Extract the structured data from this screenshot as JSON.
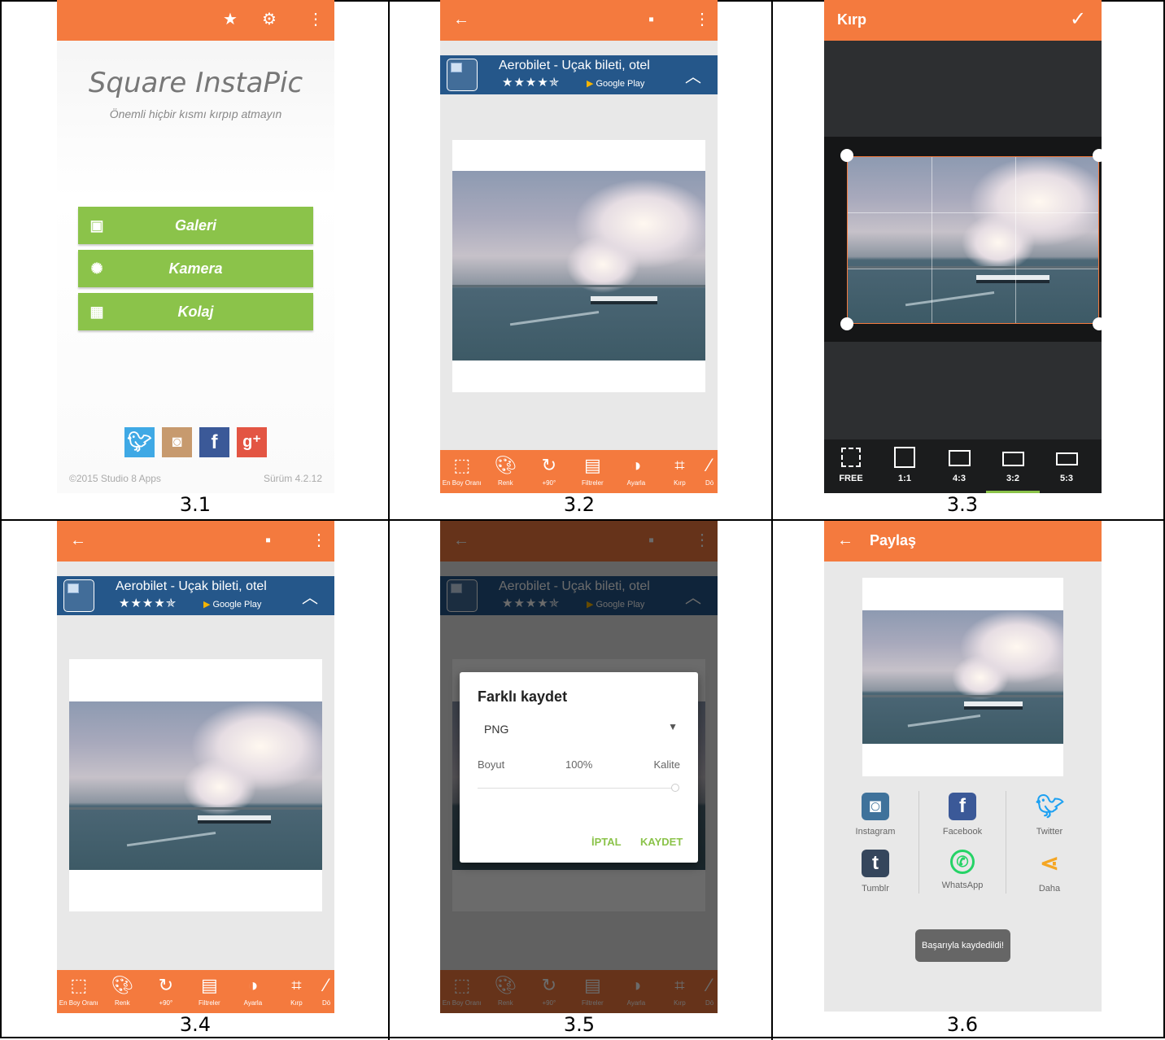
{
  "captions": [
    "3.1",
    "3.2",
    "3.3",
    "3.4",
    "3.5",
    "3.6"
  ],
  "colors": {
    "accent": "#f47a3e",
    "green": "#8bc34a",
    "ad_bg": "#25578a",
    "crop_bg": "#2d2f31"
  },
  "screen1": {
    "app_title": "Square InstaPic",
    "subtitle": "Önemli hiçbir kısmı kırpıp atmayın",
    "buttons": [
      {
        "label": "Galeri",
        "icon": "image-icon"
      },
      {
        "label": "Kamera",
        "icon": "camera-shutter-icon"
      },
      {
        "label": "Kolaj",
        "icon": "collage-icon"
      }
    ],
    "social": [
      "twitter-icon",
      "instagram-icon",
      "facebook-icon",
      "google-plus-icon"
    ],
    "copyright": "©2015 Studio 8 Apps",
    "version": "Sürüm 4.2.12"
  },
  "ad": {
    "title": "Aerobilet - Uçak bileti, otel",
    "stars": "★★★★✯",
    "store": "Google Play"
  },
  "toolbar": [
    {
      "label": "En Boy Oranı",
      "icon": "aspect-ratio-icon"
    },
    {
      "label": "Renk",
      "icon": "palette-icon"
    },
    {
      "label": "+90°",
      "icon": "rotate-icon"
    },
    {
      "label": "Filtreler",
      "icon": "filters-icon"
    },
    {
      "label": "Ayarla",
      "icon": "adjust-icon"
    },
    {
      "label": "Kırp",
      "icon": "crop-icon"
    },
    {
      "label": "Dö",
      "icon": "more-icon"
    }
  ],
  "screen3": {
    "title": "Kırp",
    "ratios": [
      "FREE",
      "1:1",
      "4:3",
      "3:2",
      "5:3"
    ],
    "selected_ratio": "3:2"
  },
  "screen5": {
    "dialog_title": "Farklı kaydet",
    "format": "PNG",
    "size_label": "Boyut",
    "size_value": "100%",
    "quality_label": "Kalite",
    "quality_level": 1.0,
    "cancel": "İPTAL",
    "save": "KAYDET"
  },
  "screen6": {
    "title": "Paylaş",
    "targets": [
      {
        "label": "Instagram",
        "icon": "instagram-icon"
      },
      {
        "label": "Facebook",
        "icon": "facebook-icon"
      },
      {
        "label": "Twitter",
        "icon": "twitter-icon"
      },
      {
        "label": "Tumblr",
        "icon": "tumblr-icon"
      },
      {
        "label": "WhatsApp",
        "icon": "whatsapp-icon"
      },
      {
        "label": "Daha",
        "icon": "share-icon"
      }
    ],
    "toast": "Başarıyla kaydedildi!"
  }
}
